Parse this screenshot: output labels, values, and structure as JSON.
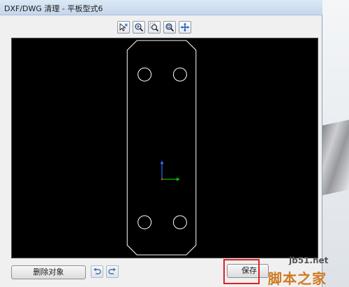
{
  "window": {
    "title": "DXF/DWG 清理 - 平板型式6"
  },
  "toolbar": {
    "tools": [
      {
        "name": "select-tool",
        "icon": "cursor-select-icon"
      },
      {
        "name": "zoom-in",
        "icon": "zoom-in-icon"
      },
      {
        "name": "zoom-area",
        "icon": "zoom-area-icon"
      },
      {
        "name": "zoom-fit",
        "icon": "zoom-fit-icon"
      },
      {
        "name": "pan",
        "icon": "pan-icon"
      }
    ]
  },
  "preview": {
    "background": "#000000",
    "stroke": "#ffffff",
    "axis_x_color": "#00cc00",
    "axis_y_color": "#2a6cff"
  },
  "footer": {
    "delete_label": "删除对象",
    "undo_icon": "undo-icon",
    "redo_icon": "redo-icon",
    "save_label": "保存"
  },
  "watermark": {
    "url": "jb51.net",
    "text": "脚本之家"
  },
  "colors": {
    "highlight": "#e02020",
    "watermark": "#d07a22"
  }
}
